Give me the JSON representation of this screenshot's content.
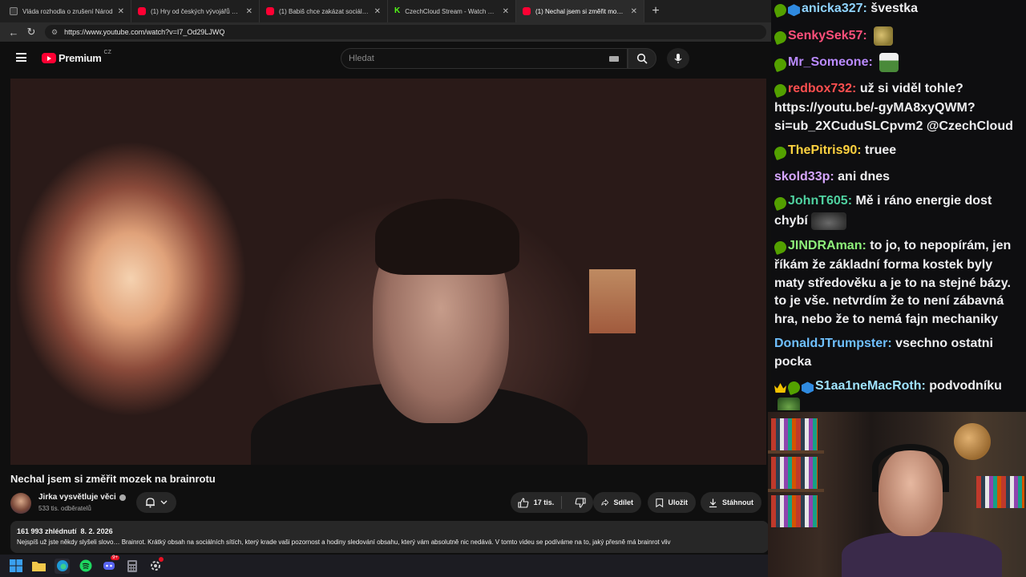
{
  "browser": {
    "tabs": [
      {
        "title": "Vláda rozhodla o zrušení Národ",
        "icon": "doc",
        "active": false
      },
      {
        "title": "(1) Hry od českých vývojářů dobýv",
        "icon": "yt",
        "active": false
      },
      {
        "title": "(1) Babiš chce zakázat sociální sítě",
        "icon": "yt",
        "active": false
      },
      {
        "title": "CzechCloud Stream - Watch Live o",
        "icon": "kick",
        "active": false
      },
      {
        "title": "(1) Nechal jsem si změřit mozek na",
        "icon": "yt",
        "active": true
      }
    ],
    "new_tab": "+",
    "url": "https://www.youtube.com/watch?v=I7_Od29LJWQ"
  },
  "youtube": {
    "logo_text": "Premium",
    "region": "CZ",
    "search_placeholder": "Hledat",
    "video_title": "Nechal jsem si změřit mozek na brainrotu",
    "channel_name": "Jirka vysvětluje věci",
    "subscribers": "533 tis. odběratelů",
    "likes": "17 tis.",
    "share_label": "Sdílet",
    "save_label": "Uložit",
    "download_label": "Stáhnout",
    "views": "161 993 zhlédnutí",
    "date": "8. 2. 2026",
    "description": "Nejspíš už jste někdy slyšeli slovo… Brainrot. Krátký obsah na sociálních sítích, který krade vaši pozornost a hodiny sledování obsahu, který vám absolutně nic nedává. V tomto videu se podíváme na to, jaký přesně má brainrot vliv"
  },
  "chat": {
    "messages": [
      {
        "user": "anicka327",
        "text": "švestka",
        "badges": [
          "green",
          "cube"
        ],
        "color": "u1",
        "emote": ""
      },
      {
        "user": "SenkySek57",
        "text": "",
        "badges": [
          "green"
        ],
        "color": "u2",
        "emote": "pepe"
      },
      {
        "user": "Mr_Someone",
        "text": "",
        "badges": [
          "green"
        ],
        "color": "u3",
        "emote": "true"
      },
      {
        "user": "redbox732",
        "text": "už si viděl tohle? https://youtu.be/-gyMA8xyQWM?si=ub_2XCuduSLCpvm2 @CzechCloud",
        "badges": [
          "green"
        ],
        "color": "u4",
        "emote": ""
      },
      {
        "user": "ThePitris90",
        "text": "truee",
        "badges": [
          "green"
        ],
        "color": "u5",
        "emote": ""
      },
      {
        "user": "skold33p",
        "text": "ani dnes",
        "badges": [],
        "color": "u6",
        "emote": ""
      },
      {
        "user": "JohnT605",
        "text": "Mě i ráno energie dost chybí",
        "badges": [
          "green"
        ],
        "color": "u7",
        "emote": "tired"
      },
      {
        "user": "JINDRAman",
        "text": "to jo, to nepopírám, jen říkám že základní forma kostek byly maty středověku a je to na stejné bázy. to je vše. netvrdím že to není zábavná hra, nebo že to nemá fajn mechaniky",
        "badges": [
          "green"
        ],
        "color": "u8",
        "emote": ""
      },
      {
        "user": "DonaldJTrumpster",
        "text": "vsechno ostatni pocka",
        "badges": [],
        "color": "u9",
        "emote": ""
      },
      {
        "user": "S1aa1neMacRoth",
        "text": "podvodníku",
        "badges": [
          "crown",
          "green",
          "cube"
        ],
        "color": "u10",
        "emote": "frog"
      }
    ]
  },
  "taskbar": {
    "icons": [
      "windows-icon",
      "file-explorer-icon",
      "edge-icon",
      "spotify-icon",
      "discord-icon",
      "calculator-icon",
      "settings-icon"
    ],
    "discord_badge": "9+"
  },
  "colors": {
    "yt_red": "#ff0033",
    "bg": "#0f0f0f",
    "chip": "#272727"
  }
}
